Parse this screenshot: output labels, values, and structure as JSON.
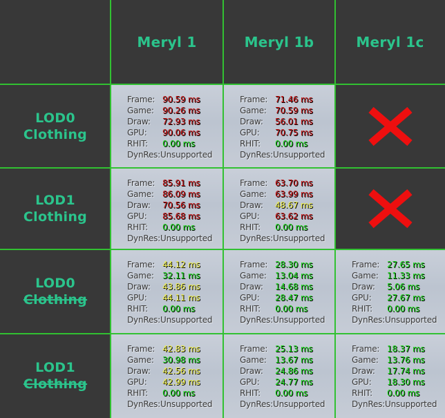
{
  "colors": {
    "red": "#c40f0f",
    "yellow": "#f1f14a",
    "green": "#18d818",
    "header_text": "#2bc48c",
    "grid_line": "#31c131",
    "background": "#383838"
  },
  "columns": [
    "Meryl 1",
    "Meryl 1b",
    "Meryl 1c"
  ],
  "rows": [
    {
      "line1": "LOD0",
      "line2": "Clothing",
      "struck": false
    },
    {
      "line1": "LOD1",
      "line2": "Clothing",
      "struck": false
    },
    {
      "line1": "LOD0",
      "line2": "Clothing",
      "struck": true
    },
    {
      "line1": "LOD1",
      "line2": "Clothing",
      "struck": true
    }
  ],
  "labels": {
    "frame": "Frame:",
    "game": "Game:",
    "draw": "Draw:",
    "gpu": "GPU:",
    "rhit": "RHIT:",
    "dynres": "DynRes:"
  },
  "cells": [
    [
      {
        "frame": "90.59 ms",
        "frame_c": "red",
        "game": "90.26 ms",
        "game_c": "red",
        "draw": "72.93 ms",
        "draw_c": "red",
        "gpu": "90.06 ms",
        "gpu_c": "red",
        "rhit": "0.00 ms",
        "rhit_c": "green",
        "dynres": "Unsupported"
      },
      {
        "frame": "71.46 ms",
        "frame_c": "red",
        "game": "70.59 ms",
        "game_c": "red",
        "draw": "56.01 ms",
        "draw_c": "red",
        "gpu": "70.75 ms",
        "gpu_c": "red",
        "rhit": "0.00 ms",
        "rhit_c": "green",
        "dynres": "Unsupported"
      },
      null
    ],
    [
      {
        "frame": "85.91 ms",
        "frame_c": "red",
        "game": "86.09 ms",
        "game_c": "red",
        "draw": "70.56 ms",
        "draw_c": "red",
        "gpu": "85.68 ms",
        "gpu_c": "red",
        "rhit": "0.00 ms",
        "rhit_c": "green",
        "dynres": "Unsupported"
      },
      {
        "frame": "63.70 ms",
        "frame_c": "red",
        "game": "63.99 ms",
        "game_c": "red",
        "draw": "48.67 ms",
        "draw_c": "yellow",
        "gpu": "63.62 ms",
        "gpu_c": "red",
        "rhit": "0.00 ms",
        "rhit_c": "green",
        "dynres": "Unsupported"
      },
      null
    ],
    [
      {
        "frame": "44.12 ms",
        "frame_c": "yellow",
        "game": "32.11 ms",
        "game_c": "green",
        "draw": "43.86 ms",
        "draw_c": "yellow",
        "gpu": "44.11 ms",
        "gpu_c": "yellow",
        "rhit": "0.00 ms",
        "rhit_c": "green",
        "dynres": "Unsupported"
      },
      {
        "frame": "28.30 ms",
        "frame_c": "green",
        "game": "13.04 ms",
        "game_c": "green",
        "draw": "14.68 ms",
        "draw_c": "green",
        "gpu": "28.47 ms",
        "gpu_c": "green",
        "rhit": "0.00 ms",
        "rhit_c": "green",
        "dynres": "Unsupported"
      },
      {
        "frame": "27.65 ms",
        "frame_c": "green",
        "game": "11.33 ms",
        "game_c": "green",
        "draw": "5.06 ms",
        "draw_c": "green",
        "gpu": "27.67 ms",
        "gpu_c": "green",
        "rhit": "0.00 ms",
        "rhit_c": "green",
        "dynres": "Unsupported"
      }
    ],
    [
      {
        "frame": "42.83 ms",
        "frame_c": "yellow",
        "game": "30.98 ms",
        "game_c": "green",
        "draw": "42.56 ms",
        "draw_c": "yellow",
        "gpu": "42.99 ms",
        "gpu_c": "yellow",
        "rhit": "0.00 ms",
        "rhit_c": "green",
        "dynres": "Unsupported"
      },
      {
        "frame": "25.13 ms",
        "frame_c": "green",
        "game": "13.67 ms",
        "game_c": "green",
        "draw": "24.86 ms",
        "draw_c": "green",
        "gpu": "24.77 ms",
        "gpu_c": "green",
        "rhit": "0.00 ms",
        "rhit_c": "green",
        "dynres": "Unsupported"
      },
      {
        "frame": "18.37 ms",
        "frame_c": "green",
        "game": "13.76 ms",
        "game_c": "green",
        "draw": "17.74 ms",
        "draw_c": "green",
        "gpu": "18.30 ms",
        "gpu_c": "green",
        "rhit": "0.00 ms",
        "rhit_c": "green",
        "dynres": "Unsupported"
      }
    ]
  ],
  "unavailable_icon": "red-x-icon"
}
